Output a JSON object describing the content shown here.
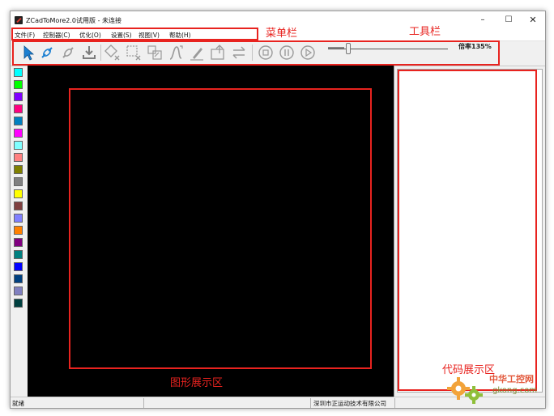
{
  "window": {
    "title": "ZCadToMore2.0试用版 - 未连接",
    "controls": {
      "minimize": "–",
      "maximize": "☐",
      "close": "✕"
    }
  },
  "menubar": {
    "items": [
      {
        "label": "文件(F)"
      },
      {
        "label": "控制器(C)"
      },
      {
        "label": "优化(O)"
      },
      {
        "label": "设置(S)"
      },
      {
        "label": "视图(V)"
      },
      {
        "label": "帮助(H)"
      }
    ]
  },
  "toolbar": {
    "tools": [
      {
        "icon": "select-arrow-icon"
      },
      {
        "icon": "connect-icon"
      },
      {
        "icon": "disconnect-icon"
      },
      {
        "icon": "download-icon"
      },
      {
        "icon": "delete-shape-icon"
      },
      {
        "icon": "delete-selection-icon"
      },
      {
        "icon": "reverse-icon"
      },
      {
        "icon": "path-icon"
      },
      {
        "icon": "edit-icon"
      },
      {
        "icon": "insert-icon"
      },
      {
        "icon": "swap-icon"
      },
      {
        "icon": "stop-icon"
      },
      {
        "icon": "pause-icon"
      },
      {
        "icon": "play-icon"
      }
    ],
    "zoom": {
      "label": "倍率135%",
      "value_percent": 135
    }
  },
  "palette": {
    "colors": [
      "#00ffff",
      "#00ff00",
      "#8000ff",
      "#ff0080",
      "#0080c0",
      "#ff00ff",
      "#80ffff",
      "#ff8080",
      "#808000",
      "#808080",
      "#ffff00",
      "#804040",
      "#8080ff",
      "#ff8000",
      "#800080",
      "#008080",
      "#0000ff",
      "#004080",
      "#8080c0",
      "#004040"
    ]
  },
  "statusbar": {
    "left": "就绪",
    "company": "深圳市正运动技术有限公司"
  },
  "annotations": {
    "menubar_label": "菜单栏",
    "toolbar_label": "工具栏",
    "canvas_label": "图形展示区",
    "code_label": "代码展示区",
    "color": "#e8231f"
  },
  "watermark": {
    "cn": "中华工控网",
    "en": "gkong.com"
  }
}
